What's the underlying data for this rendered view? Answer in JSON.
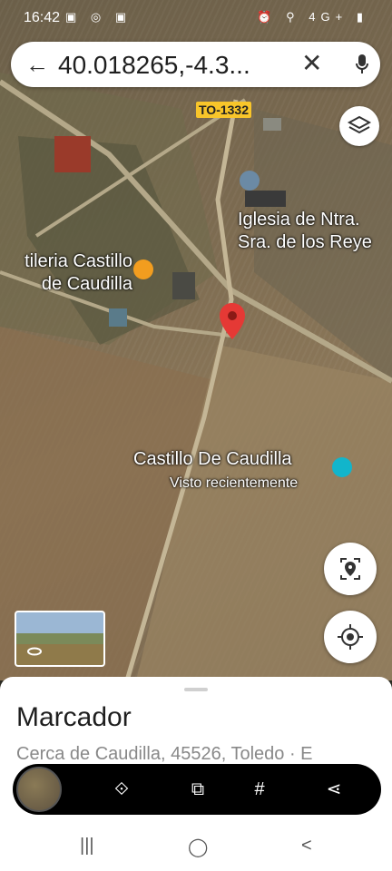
{
  "status_bar": {
    "time": "16:42",
    "left_icons": "▣ ◎ ▣",
    "right_icons": "⏰ ⚲ 4G+ ▮"
  },
  "search": {
    "query": "40.018265,-4.3..."
  },
  "map": {
    "road_label": "TO-1332",
    "places": [
      {
        "name_line1": "Iglesia de Ntra.",
        "name_line2": "Sra. de los Reye"
      },
      {
        "name_line1": "tileria Castillo",
        "name_line2": "de Caudilla"
      },
      {
        "name_line1": "Castillo De Caudilla",
        "sub": "Visto recientemente"
      }
    ],
    "pin_color": "#e53935",
    "poi_colors": {
      "church": "#6b8aa5",
      "bar": "#f29d1f",
      "castle": "#12b5cb"
    }
  },
  "sheet": {
    "title": "Marcador",
    "address": "Cerca de Caudilla, 45526, Toledo · E"
  },
  "toolbar": {
    "scan": "⟐",
    "crop": "⧉",
    "hash": "#",
    "share": "⋖"
  },
  "navbar": {
    "recents": "|||",
    "home": "◯",
    "back": "<"
  }
}
